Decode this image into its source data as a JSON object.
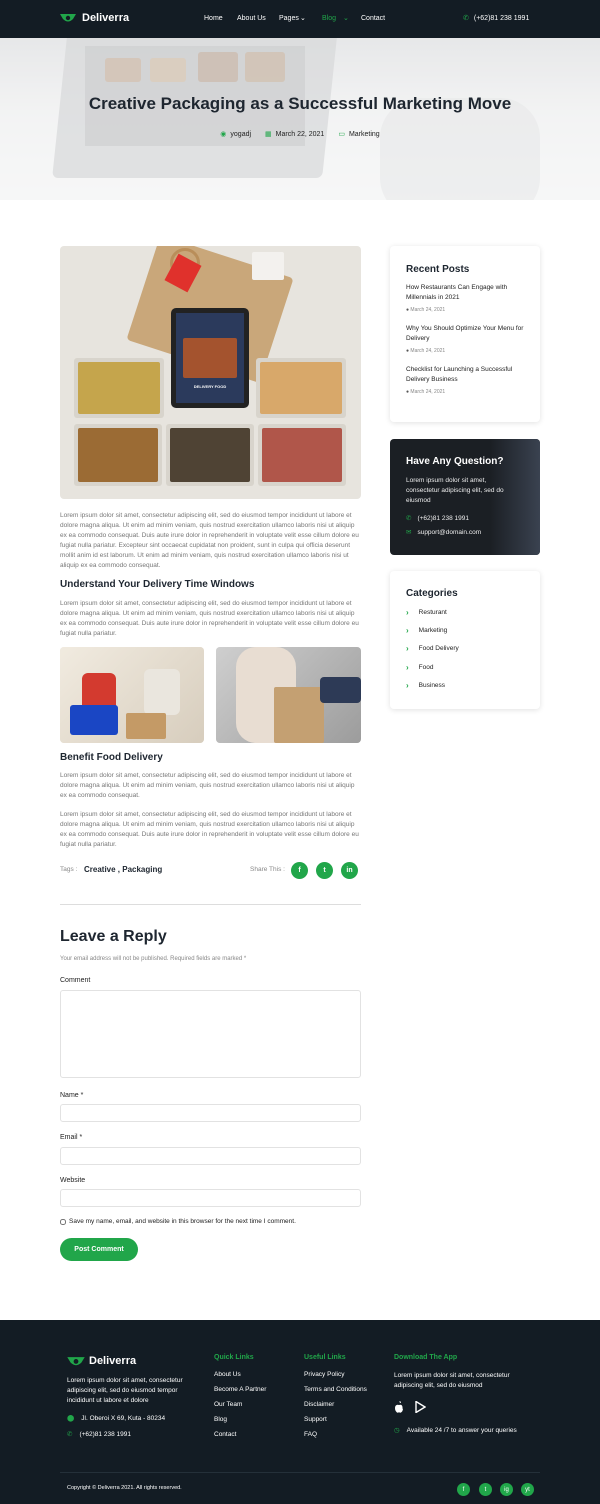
{
  "header": {
    "brand": "Deliverra",
    "nav": [
      "Home",
      "About Us",
      "Pages",
      "Blog",
      "Contact"
    ],
    "phone": "(+62)81 238 1991"
  },
  "hero": {
    "title": "Creative Packaging as a Successful Marketing Move",
    "author": "yogadj",
    "date": "March 22, 2021",
    "category": "Marketing"
  },
  "article": {
    "image_label": "DELIVERY FOOD",
    "intro": "Lorem ipsum dolor sit amet, consectetur adipiscing elit, sed do eiusmod tempor incididunt ut labore et dolore magna aliqua. Ut enim ad minim veniam, quis nostrud exercitation ullamco laboris nisi ut aliquip ex ea commodo consequat. Duis aute irure dolor in reprehenderit in voluptate velit esse cillum dolore eu fugiat nulla pariatur. Excepteur sint occaecat cupidatat non proident, sunt in culpa qui officia deserunt mollit anim id est laborum. Ut enim ad minim veniam, quis nostrud exercitation ullamco laboris nisi ut aliquip ex ea commodo consequat.",
    "h1": "Understand Your Delivery Time Windows",
    "p1": "Lorem ipsum dolor sit amet, consectetur adipiscing elit, sed do eiusmod tempor incididunt ut labore et dolore magna aliqua. Ut enim ad minim veniam, quis nostrud exercitation ullamco laboris nisi ut aliquip ex ea commodo consequat. Duis aute irure dolor in reprehenderit in voluptate velit esse cillum dolore eu fugiat nulla pariatur.",
    "h2": "Benefit Food Delivery",
    "p2": "Lorem ipsum dolor sit amet, consectetur adipiscing elit, sed do eiusmod tempor incididunt ut labore et dolore magna aliqua. Ut enim ad minim veniam, quis nostrud exercitation ullamco laboris nisi ut aliquip ex ea commodo consequat.",
    "p3": "Lorem ipsum dolor sit amet, consectetur adipiscing elit, sed do eiusmod tempor incididunt ut labore et dolore magna aliqua. Ut enim ad minim veniam, quis nostrud exercitation ullamco laboris nisi ut aliquip ex ea commodo consequat. Duis aute irure dolor in reprehenderit in voluptate velit esse cillum dolore eu fugiat nulla pariatur.",
    "tags_label": "Tags :",
    "tags": "Creative , Packaging",
    "share_label": "Share This :",
    "share_icons": [
      "f",
      "t",
      "in"
    ]
  },
  "reply": {
    "title": "Leave a Reply",
    "note": "Your email address will not be published. Required fields are marked *",
    "comment_label": "Comment",
    "name_label": "Name *",
    "email_label": "Email *",
    "website_label": "Website",
    "save_label": "Save my name, email, and website in this browser for the next time I comment.",
    "submit": "Post Comment"
  },
  "sidebar": {
    "recent_title": "Recent Posts",
    "posts": [
      {
        "title": "How Restaurants Can Engage with Millennials in 2021",
        "date": "March 24, 2021"
      },
      {
        "title": "Why You Should Optimize Your Menu for Delivery",
        "date": "March 24, 2021"
      },
      {
        "title": "Checklist for Launching a Successful Delivery Business",
        "date": "March 24, 2021"
      }
    ],
    "question_title": "Have Any Question?",
    "question_text": "Lorem ipsum dolor sit amet, consectetur adipiscing elit, sed do eiusmod",
    "question_phone": "(+62)81 238 1991",
    "question_email": "support@domain.com",
    "categories_title": "Categories",
    "categories": [
      "Resturant",
      "Marketing",
      "Food Delivery",
      "Food",
      "Business"
    ]
  },
  "footer": {
    "brand": "Deliverra",
    "about": "Lorem ipsum dolor sit amet, consectetur adipiscing elit, sed do eiusmod tempor incididunt ut labore et dolore",
    "address": "Jl. Oberoi X 69, Kuta - 80234",
    "phone": "(+62)81 238 1991",
    "quick_title": "Quick Links",
    "quick_links": [
      "About Us",
      "Become A Partner",
      "Our Team",
      "Blog",
      "Contact"
    ],
    "useful_title": "Useful Links",
    "useful_links": [
      "Privacy Policy",
      "Terms and Conditions",
      "Disclaimer",
      "Support",
      "FAQ"
    ],
    "app_title": "Download The App",
    "app_text": "Lorem ipsum dolor sit amet, consectetur adipiscing elit, sed do eiusmod",
    "availability": "Available 24 /7 to answer your queries",
    "copyright": "Copyright © Deliverra 2021. All rights reserved.",
    "social_icons": [
      "f",
      "t",
      "ig",
      "yt"
    ]
  },
  "colors": {
    "accent": "#21a64a",
    "dark": "#131c24"
  }
}
